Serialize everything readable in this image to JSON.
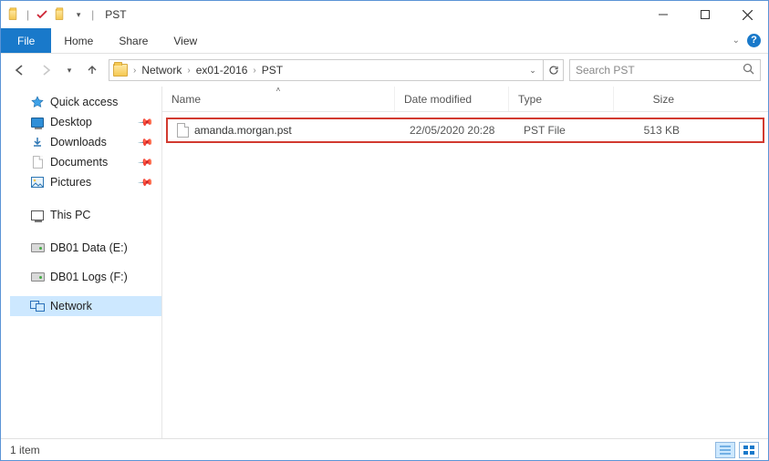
{
  "window": {
    "title": "PST"
  },
  "ribbon": {
    "file_label": "File",
    "tabs": [
      "Home",
      "Share",
      "View"
    ]
  },
  "breadcrumb": {
    "items": [
      "Network",
      "ex01-2016",
      "PST"
    ]
  },
  "search": {
    "placeholder": "Search PST"
  },
  "nav": {
    "quick_access": {
      "label": "Quick access",
      "items": [
        {
          "label": "Desktop",
          "pinned": true
        },
        {
          "label": "Downloads",
          "pinned": true
        },
        {
          "label": "Documents",
          "pinned": true
        },
        {
          "label": "Pictures",
          "pinned": true
        }
      ]
    },
    "this_pc": {
      "label": "This PC"
    },
    "drives": [
      {
        "label": "DB01 Data (E:)"
      },
      {
        "label": "DB01 Logs (F:)"
      }
    ],
    "network": {
      "label": "Network"
    }
  },
  "columns": {
    "name": "Name",
    "date": "Date modified",
    "type": "Type",
    "size": "Size"
  },
  "files": [
    {
      "name": "amanda.morgan.pst",
      "date": "22/05/2020 20:28",
      "type": "PST File",
      "size": "513 KB"
    }
  ],
  "status": {
    "count_label": "1 item"
  }
}
